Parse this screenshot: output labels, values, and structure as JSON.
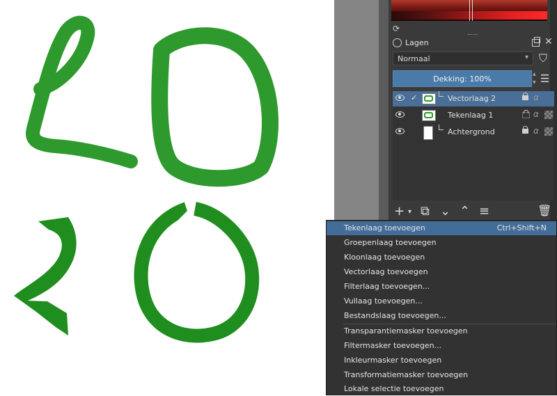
{
  "canvas": {
    "stroke_color": "#2e9a2e",
    "ribbon_color": "#1f8e1f"
  },
  "panel": {
    "title": "Lagen",
    "blend_mode": "Normaal",
    "opacity_label": "Dekking:  100%",
    "accent_color": "#4a7aa8"
  },
  "layers": [
    {
      "name": "Vectorlaag 2",
      "selected": true,
      "locked": true
    },
    {
      "name": "Tekenlaag 1",
      "selected": false,
      "locked": false
    },
    {
      "name": "Achtergrond",
      "selected": false,
      "locked": true
    }
  ],
  "bottom_bar": {
    "add": "+",
    "dropdown": "▾",
    "duplicate": "⧉",
    "down": "⌄",
    "up": "⌃",
    "properties": "≡",
    "delete": "🗑"
  },
  "context_menu": {
    "items": [
      {
        "label": "Tekenlaag toevoegen",
        "shortcut": "Ctrl+Shift+N"
      },
      {
        "label": "Groepenlaag toevoegen"
      },
      {
        "label": "Kloonlaag toevoegen"
      },
      {
        "label": "Vectorlaag toevoegen"
      },
      {
        "label": "Filterlaag toevoegen..."
      },
      {
        "label": "Vullaag toevoegen..."
      },
      {
        "label": "Bestandslaag toevoegen..."
      },
      {
        "label": "Transparantiemasker toevoegen"
      },
      {
        "label": "Filtermasker toevoegen..."
      },
      {
        "label": "Inkleurmasker toevoegen"
      },
      {
        "label": "Transformatiemasker toevoegen"
      },
      {
        "label": "Lokale selectie toevoegen"
      }
    ]
  }
}
